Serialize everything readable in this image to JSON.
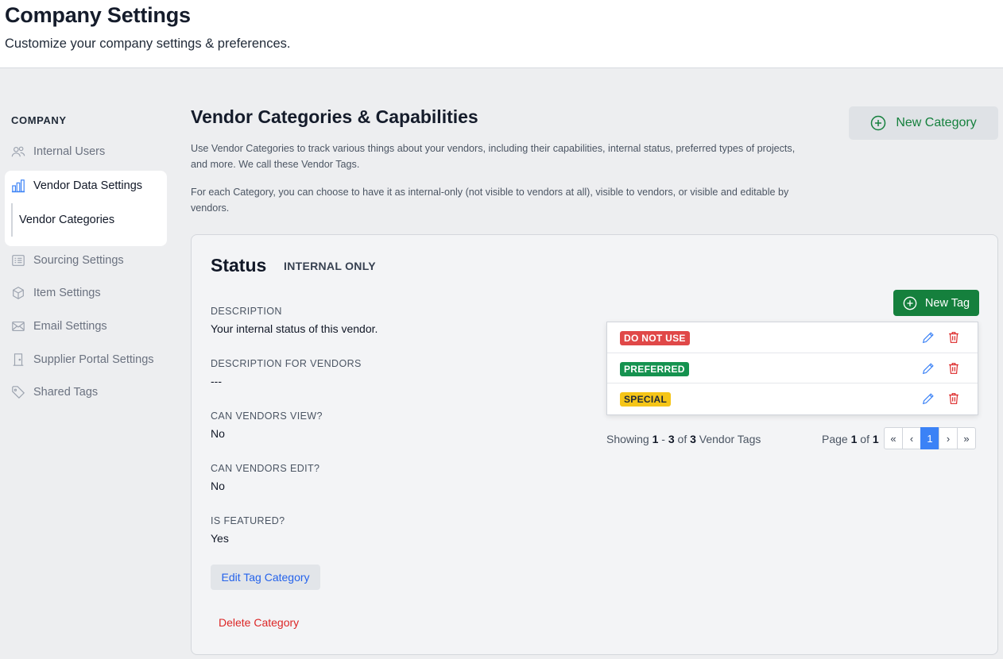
{
  "header": {
    "title": "Company Settings",
    "subtitle": "Customize your company settings & preferences."
  },
  "sidebar": {
    "heading": "COMPANY",
    "items": [
      {
        "label": "Internal Users",
        "icon": "users-icon"
      },
      {
        "label": "Vendor Data Settings",
        "icon": "building-chart-icon"
      },
      {
        "label": "Vendor Categories",
        "icon": ""
      },
      {
        "label": "Sourcing Settings",
        "icon": "list-card-icon"
      },
      {
        "label": "Item Settings",
        "icon": "cube-icon"
      },
      {
        "label": "Email Settings",
        "icon": "envelope-icon"
      },
      {
        "label": "Supplier Portal Settings",
        "icon": "door-icon"
      },
      {
        "label": "Shared Tags",
        "icon": "tag-icon"
      }
    ]
  },
  "main": {
    "title": "Vendor Categories & Capabilities",
    "new_category_label": "New Category",
    "description_1": "Use Vendor Categories to track various things about your vendors, including their capabilities, internal status, preferred types of projects, and more. We call these Vendor Tags.",
    "description_2": "For each Category, you can choose to have it as internal-only (not visible to vendors at all), visible to vendors, or visible and editable by vendors."
  },
  "category": {
    "name": "Status",
    "visibility": "INTERNAL ONLY",
    "fields": [
      {
        "label": "DESCRIPTION",
        "value": "Your internal status of this vendor."
      },
      {
        "label": "DESCRIPTION FOR VENDORS",
        "value": "---"
      },
      {
        "label": "CAN VENDORS VIEW?",
        "value": "No"
      },
      {
        "label": "CAN VENDORS EDIT?",
        "value": "No"
      },
      {
        "label": "IS FEATURED?",
        "value": "Yes"
      }
    ],
    "edit_label": "Edit Tag Category",
    "delete_label": "Delete Category",
    "new_tag_label": "New Tag",
    "tags": [
      {
        "label": "DO NOT USE",
        "bg": "#e04848",
        "fg": "#ffffff"
      },
      {
        "label": "PREFERRED",
        "bg": "#15924f",
        "fg": "#ffffff"
      },
      {
        "label": "SPECIAL",
        "bg": "#f5c518",
        "fg": "#1f2937"
      }
    ],
    "showing": {
      "prefix": "Showing",
      "from": "1",
      "sep": "-",
      "to": "3",
      "of": "of",
      "total": "3",
      "suffix": "Vendor Tags"
    },
    "page": {
      "prefix": "Page",
      "current": "1",
      "of": "of",
      "total": "1"
    },
    "pager": [
      "«",
      "‹",
      "1",
      "›",
      "»"
    ]
  },
  "colors": {
    "accent_green": "#15803d",
    "link_blue": "#2563eb",
    "danger_red": "#dc2626",
    "pager_active": "#3b82f6"
  }
}
